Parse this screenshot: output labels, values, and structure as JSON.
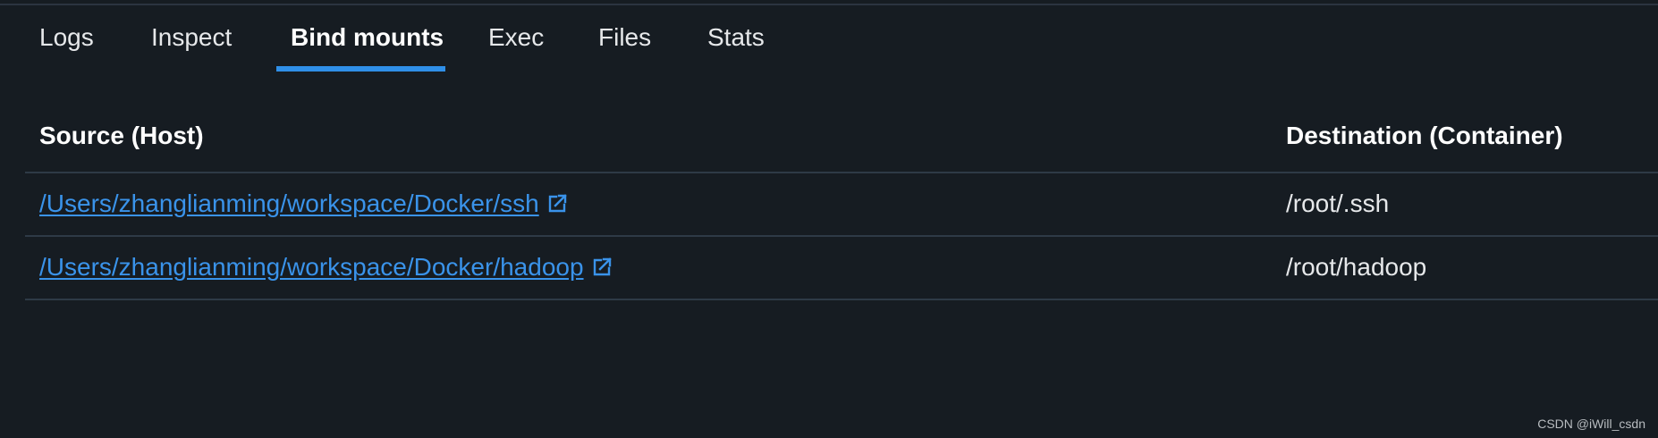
{
  "tabs": [
    {
      "label": "Logs",
      "active": false
    },
    {
      "label": "Inspect",
      "active": false
    },
    {
      "label": "Bind mounts",
      "active": true
    },
    {
      "label": "Exec",
      "active": false
    },
    {
      "label": "Files",
      "active": false
    },
    {
      "label": "Stats",
      "active": false
    }
  ],
  "table": {
    "headers": {
      "source": "Source (Host)",
      "destination": "Destination (Container)"
    },
    "rows": [
      {
        "source": "/Users/zhanglianming/workspace/Docker/ssh",
        "destination": "/root/.ssh",
        "icon": "external-link-icon"
      },
      {
        "source": "/Users/zhanglianming/workspace/Docker/hadoop",
        "destination": "/root/hadoop",
        "icon": "external-link-icon"
      }
    ]
  },
  "watermark": "CSDN @iWill_csdn",
  "colors": {
    "background": "#161c22",
    "accent": "#2f8fe8",
    "link": "#3a93ea",
    "divider": "#2e3a46"
  }
}
